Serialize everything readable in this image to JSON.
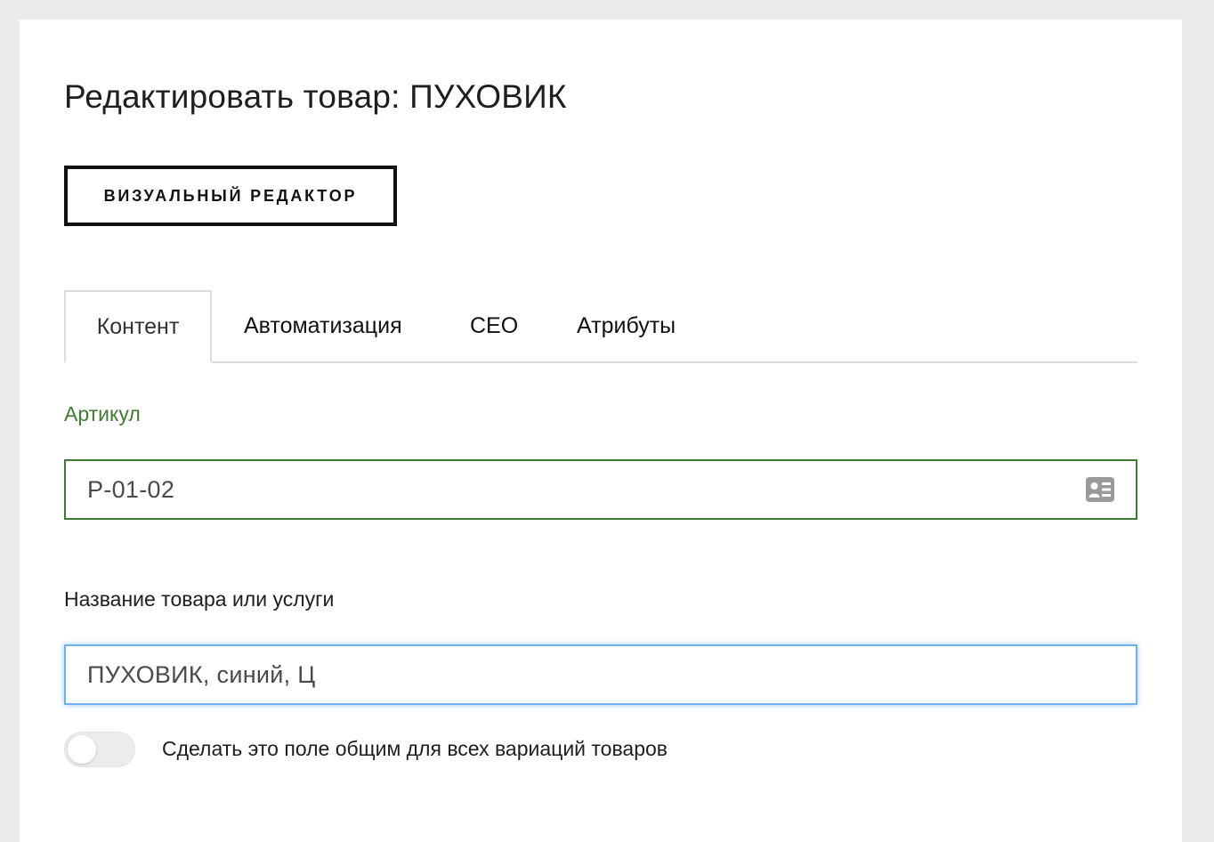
{
  "page": {
    "title": "Редактировать товар: ПУХОВИК"
  },
  "toolbar": {
    "visual_editor_label": "ВИЗУАЛЬНЫЙ РЕДАКТОР"
  },
  "tabs": [
    {
      "label": "Контент",
      "active": true
    },
    {
      "label": "Автоматизация",
      "active": false
    },
    {
      "label": "СЕО",
      "active": false
    },
    {
      "label": "Атрибуты",
      "active": false
    }
  ],
  "fields": {
    "sku": {
      "label": "Артикул",
      "value": "P-01-02",
      "icon": "contact-card-icon"
    },
    "name": {
      "label": "Название товара или услуги",
      "value": "ПУХОВИК, синий, Ц"
    }
  },
  "shared_toggle": {
    "label": "Сделать это поле общим для всех вариаций товаров",
    "enabled": false
  },
  "colors": {
    "background": "#ebebeb",
    "panel": "#ffffff",
    "accent_green": "#3e7b32",
    "focus_blue": "#6fb0e8",
    "icon_gray": "#9a9a9a"
  }
}
